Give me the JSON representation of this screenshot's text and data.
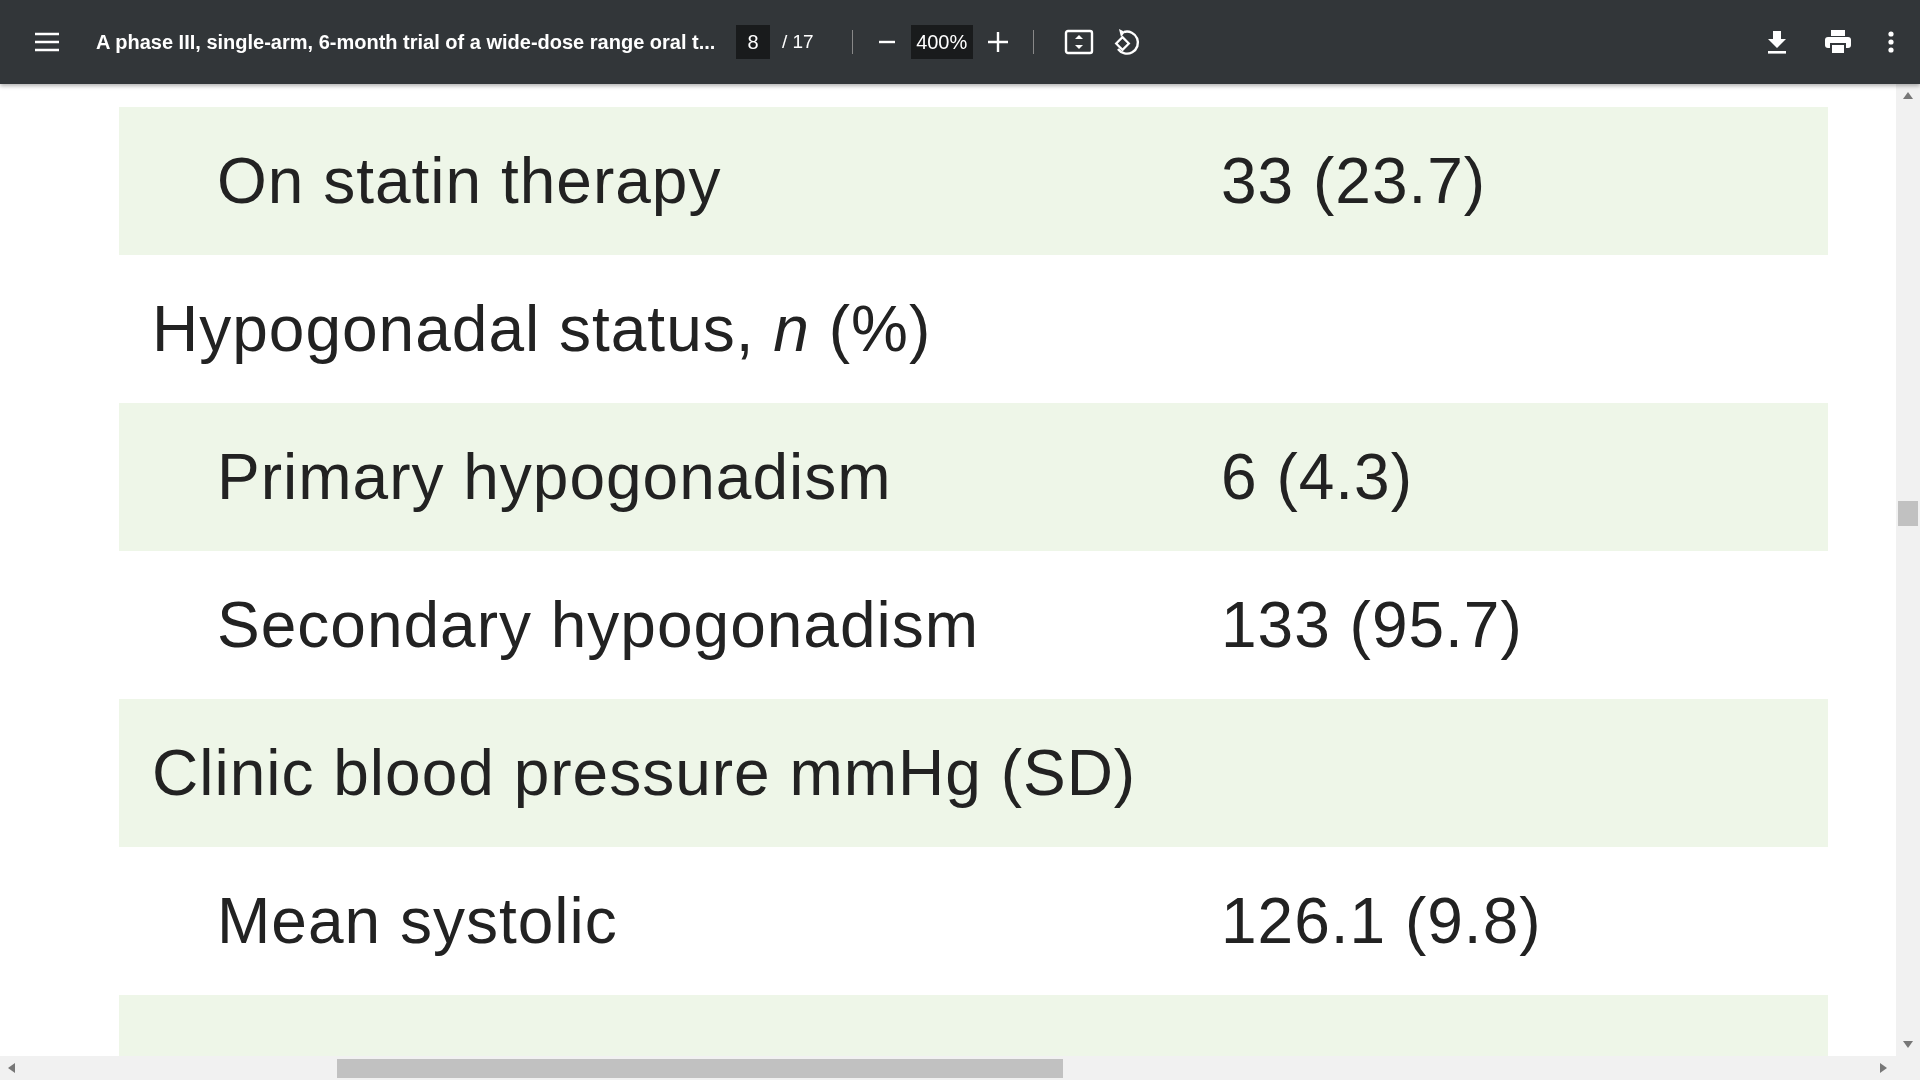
{
  "toolbar": {
    "title": "A phase III, single-arm, 6-month trial of a wide-dose range oral t...",
    "page_current": "8",
    "page_total": "/ 17",
    "zoom": "400%"
  },
  "table": {
    "rows": [
      {
        "kind": "item",
        "label": "On statin therapy",
        "value": "33 (23.7)",
        "shaded": true
      },
      {
        "kind": "header",
        "label": "Hypogonadal status, *n* (%)",
        "shaded": false
      },
      {
        "kind": "item",
        "label": "Primary hypogonadism",
        "value": "6 (4.3)",
        "shaded": true
      },
      {
        "kind": "item",
        "label": "Secondary hypogonadism",
        "value": "133 (95.7)",
        "shaded": false
      },
      {
        "kind": "header",
        "label": "Clinic blood pressure mmHg (SD)",
        "shaded": true
      },
      {
        "kind": "item",
        "label": "Mean systolic",
        "value": "126.1 (9.8)",
        "shaded": false
      },
      {
        "kind": "item",
        "shaded": true
      }
    ]
  }
}
